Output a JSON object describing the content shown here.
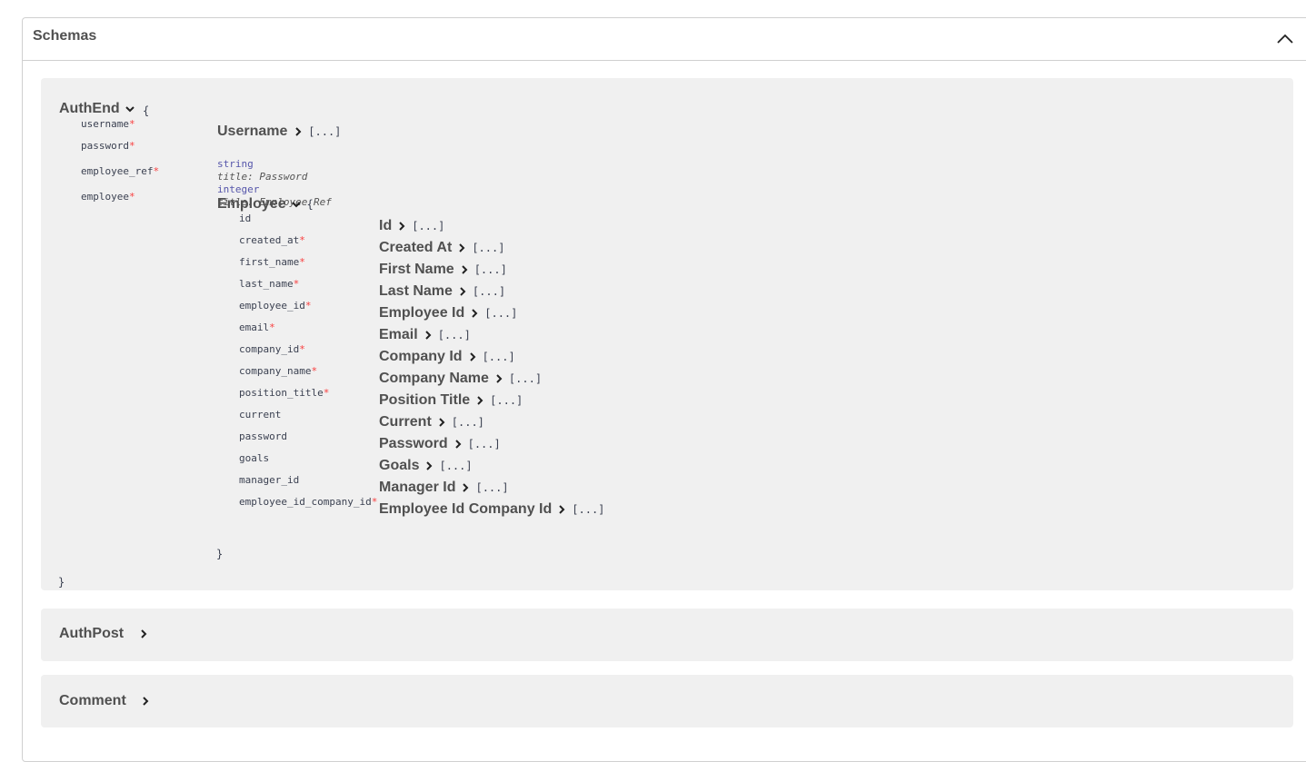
{
  "schemas": {
    "title": "Schemas",
    "expanded": true,
    "models": {
      "auth_end": {
        "name": "AuthEnd",
        "open_brace": "{",
        "close_brace": "}",
        "properties": [
          {
            "name": "username",
            "required": true
          },
          {
            "name": "password",
            "required": true
          },
          {
            "name": "employee_ref",
            "required": true
          },
          {
            "name": "employee",
            "required": true
          }
        ],
        "details": {
          "username": {
            "title": "Username",
            "ellipsis": "[...]"
          },
          "password": {
            "type": "string",
            "title_meta": "title: Password"
          },
          "employee_ref": {
            "type": "integer",
            "title_meta": "title: Employee Ref"
          },
          "employee": {
            "name": "Employee",
            "open_brace": "{",
            "close_brace": "}",
            "properties": [
              {
                "name": "id",
                "required": false,
                "title": "Id"
              },
              {
                "name": "created_at",
                "required": true,
                "title": "Created At"
              },
              {
                "name": "first_name",
                "required": true,
                "title": "First Name"
              },
              {
                "name": "last_name",
                "required": true,
                "title": "Last Name"
              },
              {
                "name": "employee_id",
                "required": true,
                "title": "Employee Id"
              },
              {
                "name": "email",
                "required": true,
                "title": "Email"
              },
              {
                "name": "company_id",
                "required": true,
                "title": "Company Id"
              },
              {
                "name": "company_name",
                "required": true,
                "title": "Company Name"
              },
              {
                "name": "position_title",
                "required": true,
                "title": "Position Title"
              },
              {
                "name": "current",
                "required": false,
                "title": "Current"
              },
              {
                "name": "password",
                "required": false,
                "title": "Password"
              },
              {
                "name": "goals",
                "required": false,
                "title": "Goals"
              },
              {
                "name": "manager_id",
                "required": false,
                "title": "Manager Id"
              },
              {
                "name": "employee_id_company_id",
                "required": true,
                "title": "Employee Id Company Id"
              }
            ],
            "ellipsis": "[...]"
          }
        }
      },
      "auth_post": {
        "name": "AuthPost"
      },
      "comment": {
        "name": "Comment"
      }
    },
    "required_marker": "*"
  }
}
